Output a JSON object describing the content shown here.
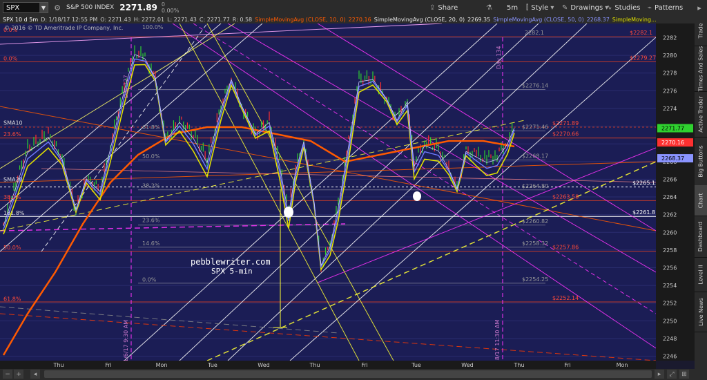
{
  "toolbar": {
    "symbol": "SPX",
    "name": "S&P 500 INDEX",
    "price": "2271.89",
    "change_top": "0",
    "change_bottom": "0.00%",
    "buttons": {
      "share": "Share",
      "flask": "",
      "timeframe": "5m",
      "style": "Style",
      "drawings": "Drawings",
      "studies": "Studies",
      "patterns": "Patterns"
    }
  },
  "legend": {
    "title": "SPX 10 d 5m",
    "date": "D: 1/18/17 12:55 PM",
    "open": "O: 2271.43",
    "high": "H: 2272.01",
    "low": "L: 2271.43",
    "close": "C: 2271.77",
    "r": "R: 0.58",
    "sma10_label": "SimpleMovingAvg (CLOSE, 10, 0)",
    "sma10_value": "2270.16",
    "sma20_label": "SimpleMovingAvg (CLOSE, 20, 0)",
    "sma20_value": "2269.35",
    "sma50_label": "SimpleMovingAvg (CLOSE, 50, 0)",
    "sma50_value": "2268.37",
    "sma_more_label": "SimpleMoving..."
  },
  "copyright": "© 2016 © TD Ameritrade IP Company, Inc.",
  "watermark": {
    "site": "pebblewriter.com",
    "subtitle": "SPX 5-min"
  },
  "price_axis": {
    "ticks": [
      "2282",
      "2280",
      "2278",
      "2276",
      "2274",
      "2272",
      "2270",
      "2268",
      "2266",
      "2264",
      "2262",
      "2260",
      "2258",
      "2256",
      "2254",
      "2252",
      "2250",
      "2248",
      "2246"
    ],
    "ymin": 2245.5,
    "ymax": 2283.6,
    "current_price": "2271.77",
    "sma10_tag": "2270.16",
    "sma50_tag": "2268.37"
  },
  "time_axis": {
    "labels": [
      "Thu",
      "Fri",
      "Mon",
      "Tue",
      "Wed",
      "Thu",
      "Fri",
      "Tue",
      "Wed",
      "Thu",
      "Fri",
      "Mon"
    ],
    "positions": [
      85,
      157,
      234,
      308,
      382,
      456,
      528,
      603,
      677,
      752,
      822,
      901
    ]
  },
  "vertical_annotations": {
    "left": "1/6/17 9:30 AM",
    "left_top": "Day 127",
    "right": "1/18/17 11:30 AM",
    "right_top": "Day 134"
  },
  "horizontal_levels": [
    {
      "label": "$2282.1",
      "price": 2282.1,
      "color": "#c0392b",
      "gray": "2282.1"
    },
    {
      "label": "$2279.27",
      "price": 2279.27,
      "color": "#c0392b"
    },
    {
      "label": "$2271.89",
      "price": 2271.89,
      "color": "#c0392b",
      "dashed": true
    },
    {
      "label": "$2270.66",
      "price": 2270.66,
      "color": "#c0392b"
    },
    {
      "label": "$2265.13",
      "price": 2265.13,
      "color": "#ffffff",
      "dashed": true
    },
    {
      "label": "$2263.58",
      "price": 2263.58,
      "color": "#c0392b"
    },
    {
      "label": "$2261.8",
      "price": 2261.8,
      "color": "#ffffff"
    },
    {
      "label": "$2257.86",
      "price": 2257.86,
      "color": "#c0392b"
    },
    {
      "label": "$2252.14",
      "price": 2252.14,
      "color": "#c0392b"
    }
  ],
  "gray_levels": [
    {
      "label": "$2276.14",
      "price": 2276.14
    },
    {
      "label": "$2271.46",
      "price": 2271.46
    },
    {
      "label": "$2268.17",
      "price": 2268.17
    },
    {
      "label": "$2264.80",
      "price": 2264.8
    },
    {
      "label": "$2260.82",
      "price": 2260.82
    },
    {
      "label": "$2258.32",
      "price": 2258.32
    },
    {
      "label": "$2254.25",
      "price": 2254.25
    }
  ],
  "fib_labels_left": [
    {
      "text": "0.0%",
      "price": 2282.5
    },
    {
      "text": "0.0%",
      "price": 2279.27
    },
    {
      "text": "SMA10",
      "price": 2272.0
    },
    {
      "text": "23.6%",
      "price": 2270.7
    },
    {
      "text": "SMA20",
      "price": 2265.6
    },
    {
      "text": "38.2%",
      "price": 2263.6
    },
    {
      "text": "161.8%",
      "price": 2261.8
    },
    {
      "text": "50.0%",
      "price": 2257.9
    },
    {
      "text": "61.8%",
      "price": 2252.1
    }
  ],
  "fib_labels_mid": [
    {
      "text": "100.0%",
      "price": 2282.8
    },
    {
      "text": "61.8%",
      "price": 2271.5
    },
    {
      "text": "50.0%",
      "price": 2268.2
    },
    {
      "text": "38.2%",
      "price": 2264.9
    },
    {
      "text": "23.6%",
      "price": 2261.0
    },
    {
      "text": "14.6%",
      "price": 2258.4
    },
    {
      "text": "0.0%",
      "price": 2254.3
    }
  ],
  "sidebar": {
    "tabs": [
      "Trade",
      "Times And Sales",
      "Active Trader",
      "Big Buttons",
      "Chart",
      "Dashboard",
      "Level II",
      "Live News"
    ]
  },
  "colors": {
    "bg": "#1b1d55",
    "sma10": "#ff5a00",
    "sma20": "#e0e000",
    "sma50": "#6f7bff",
    "fib": "#c0392b"
  }
}
